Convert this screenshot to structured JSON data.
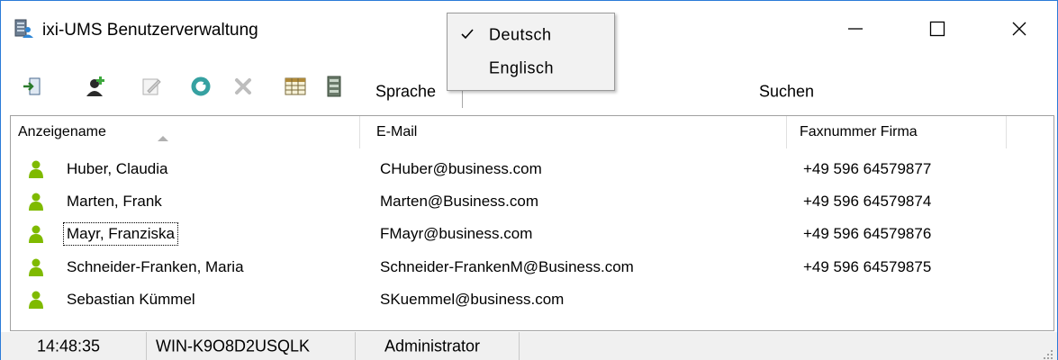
{
  "window": {
    "title": "ixi-UMS Benutzerverwaltung",
    "app_icon": "server-user-icon",
    "controls": [
      "minimize-icon",
      "maximize-icon",
      "close-icon"
    ]
  },
  "toolbar": {
    "sprache_label": "Sprache",
    "search_label": "Suchen",
    "search_value": "",
    "icons": [
      "logout-icon",
      "add-user-icon",
      "edit-user-icon",
      "refresh-icon",
      "delete-icon",
      "columns-icon",
      "server-icon"
    ]
  },
  "language_menu": {
    "items": [
      {
        "label": "Deutsch",
        "checked": true
      },
      {
        "label": "Englisch",
        "checked": false
      }
    ]
  },
  "list": {
    "columns": [
      {
        "label": "Anzeigename",
        "sorted": "ascending"
      },
      {
        "label": "E-Mail"
      },
      {
        "label": "Faxnummer Firma"
      }
    ],
    "rows": [
      {
        "name": "Huber, Claudia",
        "email": "CHuber@business.com",
        "fax": "+49 596 64579877"
      },
      {
        "name": "Marten, Frank",
        "email": "Marten@Business.com",
        "fax": "+49 596 64579874"
      },
      {
        "name": "Mayr, Franziska",
        "email": "FMayr@business.com",
        "fax": "+49 596 64579876",
        "focused": true
      },
      {
        "name": "Schneider-Franken, Maria",
        "email": "Schneider-FrankenM@Business.com",
        "fax": "+49 596 64579875"
      },
      {
        "name": "Sebastian Kümmel",
        "email": "SKuemmel@business.com",
        "fax": ""
      }
    ]
  },
  "statusbar": {
    "time": "14:48:35",
    "host": "WIN-K9O8D2USQLK",
    "user": "Administrator"
  },
  "colors": {
    "user_icon": "#7fba00",
    "accent_border": "#2b7bd8",
    "statusbar_bg": "#f0f0f0"
  }
}
